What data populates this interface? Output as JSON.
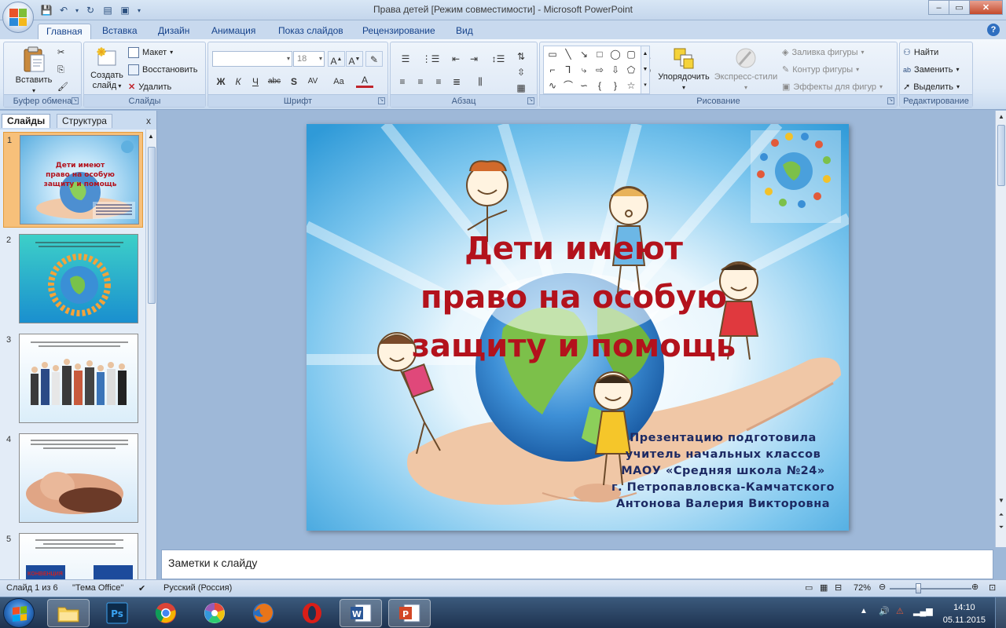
{
  "window": {
    "title": "Права детей [Режим совместимости] - Microsoft PowerPoint",
    "controls": {
      "minimize": "–",
      "maximize": "▭",
      "close": "✕"
    }
  },
  "ribbon_tabs": [
    "Главная",
    "Вставка",
    "Дизайн",
    "Анимация",
    "Показ слайдов",
    "Рецензирование",
    "Вид"
  ],
  "ribbon": {
    "clipboard": {
      "label": "Буфер обмена",
      "paste": "Вставить"
    },
    "slides": {
      "label": "Слайды",
      "new_slide_line1": "Создать",
      "new_slide_line2": "слайд",
      "layout": "Макет",
      "reset": "Восстановить",
      "delete": "Удалить"
    },
    "font": {
      "label": "Шрифт",
      "font_name": "",
      "font_size": "18",
      "bold": "Ж",
      "italic": "К",
      "underline": "Ч",
      "strike": "abc",
      "shadow": "S",
      "spacing": "AV",
      "case": "Aa",
      "color": "A"
    },
    "paragraph": {
      "label": "Абзац"
    },
    "drawing": {
      "label": "Рисование",
      "arrange": "Упорядочить",
      "quick_styles": "Экспресс-стили",
      "shape_fill": "Заливка фигуры",
      "shape_outline": "Контур фигуры",
      "shape_effects": "Эффекты для фигур"
    },
    "editing": {
      "label": "Редактирование",
      "find": "Найти",
      "replace": "Заменить",
      "select": "Выделить"
    }
  },
  "slides_pane": {
    "tabs": {
      "slides": "Слайды",
      "outline": "Структура"
    },
    "close": "x",
    "slides": [
      {
        "num": "1"
      },
      {
        "num": "2"
      },
      {
        "num": "3"
      },
      {
        "num": "4"
      },
      {
        "num": "5"
      }
    ],
    "thumb5_text": "КОНВЕНЦИЯ"
  },
  "slide": {
    "title_line1": "Дети имеют",
    "title_line2": "право на особую",
    "title_line3": "защиту и помощь",
    "author_line1": "Презентацию подготовила",
    "author_line2": "учитель начальных классов",
    "author_line3": "МАОУ «Средняя школа №24»",
    "author_line4": "г. Петропавловска-Камчатского",
    "author_line5": "Антонова Валерия Викторовна"
  },
  "notes": {
    "placeholder": "Заметки к слайду"
  },
  "status": {
    "slide_info": "Слайд 1 из 6",
    "theme": "\"Тема Office\"",
    "language": "Русский (Россия)",
    "zoom": "72%"
  },
  "taskbar": {
    "time": "14:10",
    "date": "05.11.2015",
    "apps": [
      "explorer",
      "photoshop",
      "chrome",
      "picasa",
      "firefox",
      "opera",
      "word",
      "powerpoint"
    ]
  },
  "colors": {
    "title_red": "#b3121c",
    "author_navy": "#1d2a63",
    "ribbon_blue": "#15428b"
  }
}
